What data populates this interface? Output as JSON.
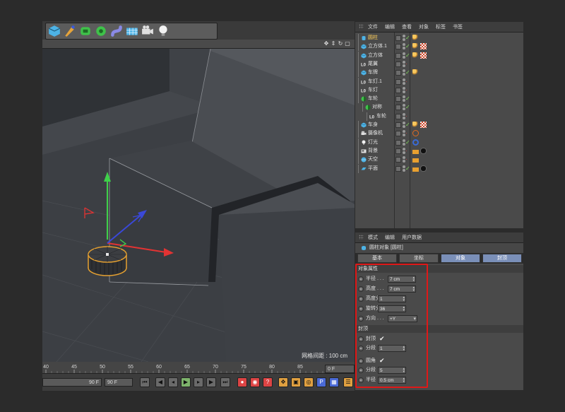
{
  "viewport": {
    "grid_spacing": "网格间距 : 100 cm"
  },
  "toolbar": {
    "tools": [
      {
        "name": "cube-icon",
        "color": "#4db3e6"
      },
      {
        "name": "pen-icon",
        "color": "#e6a43a"
      },
      {
        "name": "subdivision-icon",
        "color": "#3fc24a"
      },
      {
        "name": "array-icon",
        "color": "#3fc24a"
      },
      {
        "name": "deformer-icon",
        "color": "#8a8ae6"
      },
      {
        "name": "floor-icon",
        "color": "#4db3e6"
      },
      {
        "name": "camera-icon",
        "color": "#e0e0e0"
      },
      {
        "name": "light-icon",
        "color": "#f2f2f2"
      }
    ]
  },
  "timeline": {
    "ticks": [
      "40",
      "45",
      "50",
      "55",
      "60",
      "65",
      "70",
      "75",
      "80",
      "85",
      "90"
    ],
    "current_frame": "0 F",
    "start_field": "90 F",
    "end_field": "90 F"
  },
  "object_manager": {
    "menu": [
      "文件",
      "编辑",
      "查看",
      "对象",
      "标签",
      "书签"
    ],
    "objects": [
      {
        "name": "圆柱",
        "indent": 0,
        "icon": "cylinder-icon",
        "color": "#4db3e6",
        "check": "✓",
        "tags": [
          "phong-tag"
        ],
        "selected": true
      },
      {
        "name": "立方体.1",
        "indent": 0,
        "icon": "cube-icon",
        "color": "#4db3e6",
        "check": "✓",
        "tags": [
          "phong-tag",
          "material-tag"
        ]
      },
      {
        "name": "立方体",
        "indent": 0,
        "icon": "cube-icon",
        "color": "#4db3e6",
        "check": "✓",
        "tags": [
          "phong-tag",
          "material-tag"
        ]
      },
      {
        "name": "尾翼",
        "indent": 0,
        "icon": "null-icon",
        "color": "#e6e6e6",
        "check": "",
        "tags": []
      },
      {
        "name": "车牌",
        "indent": 0,
        "icon": "cube-icon",
        "color": "#4db3e6",
        "check": "✓",
        "tags": [
          "phong-tag"
        ]
      },
      {
        "name": "车灯.1",
        "indent": 0,
        "icon": "null-icon",
        "color": "#e6e6e6",
        "check": "",
        "tags": []
      },
      {
        "name": "车灯",
        "indent": 0,
        "icon": "null-icon",
        "color": "#e6e6e6",
        "check": "",
        "tags": []
      },
      {
        "name": "车轮",
        "indent": 0,
        "icon": "symmetry-icon",
        "color": "#3fc24a",
        "check": "✓",
        "tags": []
      },
      {
        "name": "对称",
        "indent": 1,
        "icon": "symmetry-icon",
        "color": "#3fc24a",
        "check": "✓",
        "tags": []
      },
      {
        "name": "车轮",
        "indent": 2,
        "icon": "null-icon",
        "color": "#e6e6e6",
        "check": "",
        "tags": []
      },
      {
        "name": "车身",
        "indent": 0,
        "icon": "cube-icon",
        "color": "#4db3e6",
        "check": "✓",
        "tags": [
          "phong-tag",
          "material-tag"
        ]
      },
      {
        "name": "摄像机",
        "indent": 0,
        "icon": "camera-icon",
        "color": "#e0e0e0",
        "check": "",
        "tags": [
          "protection-tag"
        ]
      },
      {
        "name": "灯光",
        "indent": 0,
        "icon": "light-icon",
        "color": "#f2f2f2",
        "check": "✓",
        "tags": [
          "target-tag"
        ]
      },
      {
        "name": "背景",
        "indent": 0,
        "icon": "background-icon",
        "color": "#e0e0e0",
        "check": "",
        "tags": [
          "compositing-tag",
          "black-material-tag"
        ]
      },
      {
        "name": "天空",
        "indent": 0,
        "icon": "sky-icon",
        "color": "#4db3e6",
        "check": "",
        "tags": [
          "compositing-tag"
        ]
      },
      {
        "name": "平面",
        "indent": 0,
        "icon": "plane-icon",
        "color": "#4db3e6",
        "check": "✓",
        "tags": [
          "compositing-tag",
          "black-material-tag"
        ]
      }
    ]
  },
  "attribute_manager": {
    "menu": [
      "模式",
      "编辑",
      "用户数据"
    ],
    "title": "圆柱对象 [圆柱]",
    "tabs": [
      {
        "label": "基本",
        "active": false
      },
      {
        "label": "坐标",
        "active": false
      },
      {
        "label": "对象",
        "active": true
      },
      {
        "label": "封顶",
        "active": true
      }
    ],
    "object_section": "对象属性",
    "object_props": [
      {
        "label": "半径 . . .",
        "value": "7 cm",
        "kind": "spin"
      },
      {
        "label": "高度 . . .",
        "value": "7 cm",
        "kind": "spin"
      },
      {
        "label": "高度分段",
        "value": "1",
        "kind": "spin"
      },
      {
        "label": "旋转分段",
        "value": "36",
        "kind": "spin"
      },
      {
        "label": "方向 . . .",
        "value": "+Y",
        "kind": "dropdown"
      }
    ],
    "caps_section": "封顶",
    "caps_props": [
      {
        "label": "封顶",
        "value": "✔",
        "kind": "check"
      },
      {
        "label": "分段",
        "value": "1",
        "kind": "spin"
      },
      {
        "label": "圆角",
        "value": "✔",
        "kind": "check"
      },
      {
        "label": "分段",
        "value": "5",
        "kind": "spin"
      },
      {
        "label": "半径",
        "value": "0.5 cm",
        "kind": "spin"
      }
    ]
  }
}
